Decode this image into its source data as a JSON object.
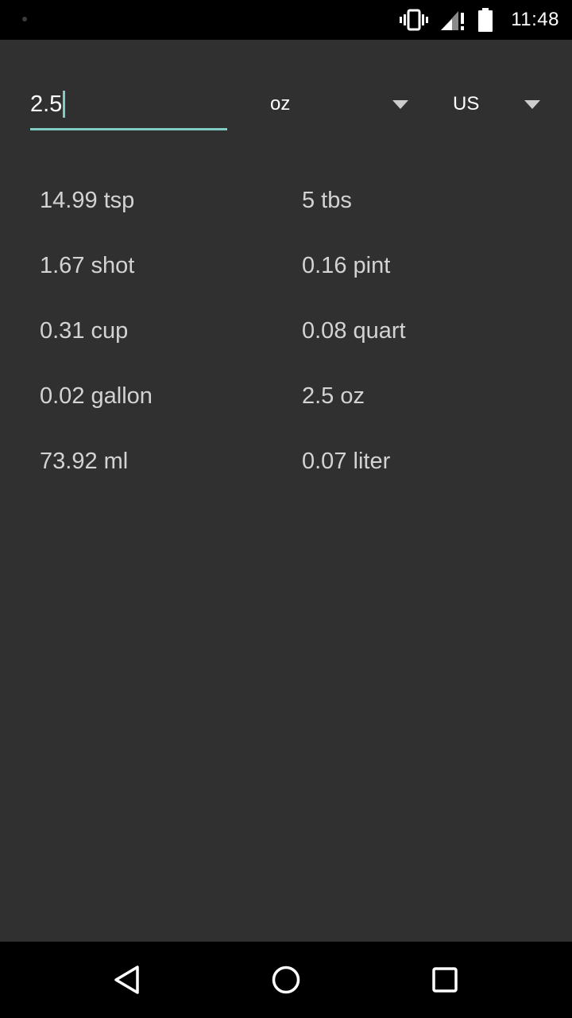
{
  "status_bar": {
    "time": "11:48",
    "icons": [
      "notification-dot-icon",
      "vibrate-icon",
      "signal-icon",
      "battery-icon"
    ]
  },
  "converter": {
    "amount_value": "2.5",
    "unit_selected": "oz",
    "system_selected": "US",
    "accent_color": "#80cbc4"
  },
  "results": [
    {
      "value": "14.99 tsp"
    },
    {
      "value": "5 tbs"
    },
    {
      "value": "1.67 shot"
    },
    {
      "value": "0.16 pint"
    },
    {
      "value": "0.31 cup"
    },
    {
      "value": "0.08 quart"
    },
    {
      "value": "0.02 gallon"
    },
    {
      "value": "2.5 oz"
    },
    {
      "value": "73.92 ml"
    },
    {
      "value": "0.07 liter"
    }
  ],
  "nav_bar": {
    "icons": [
      "back-icon",
      "home-icon",
      "recents-icon"
    ]
  }
}
